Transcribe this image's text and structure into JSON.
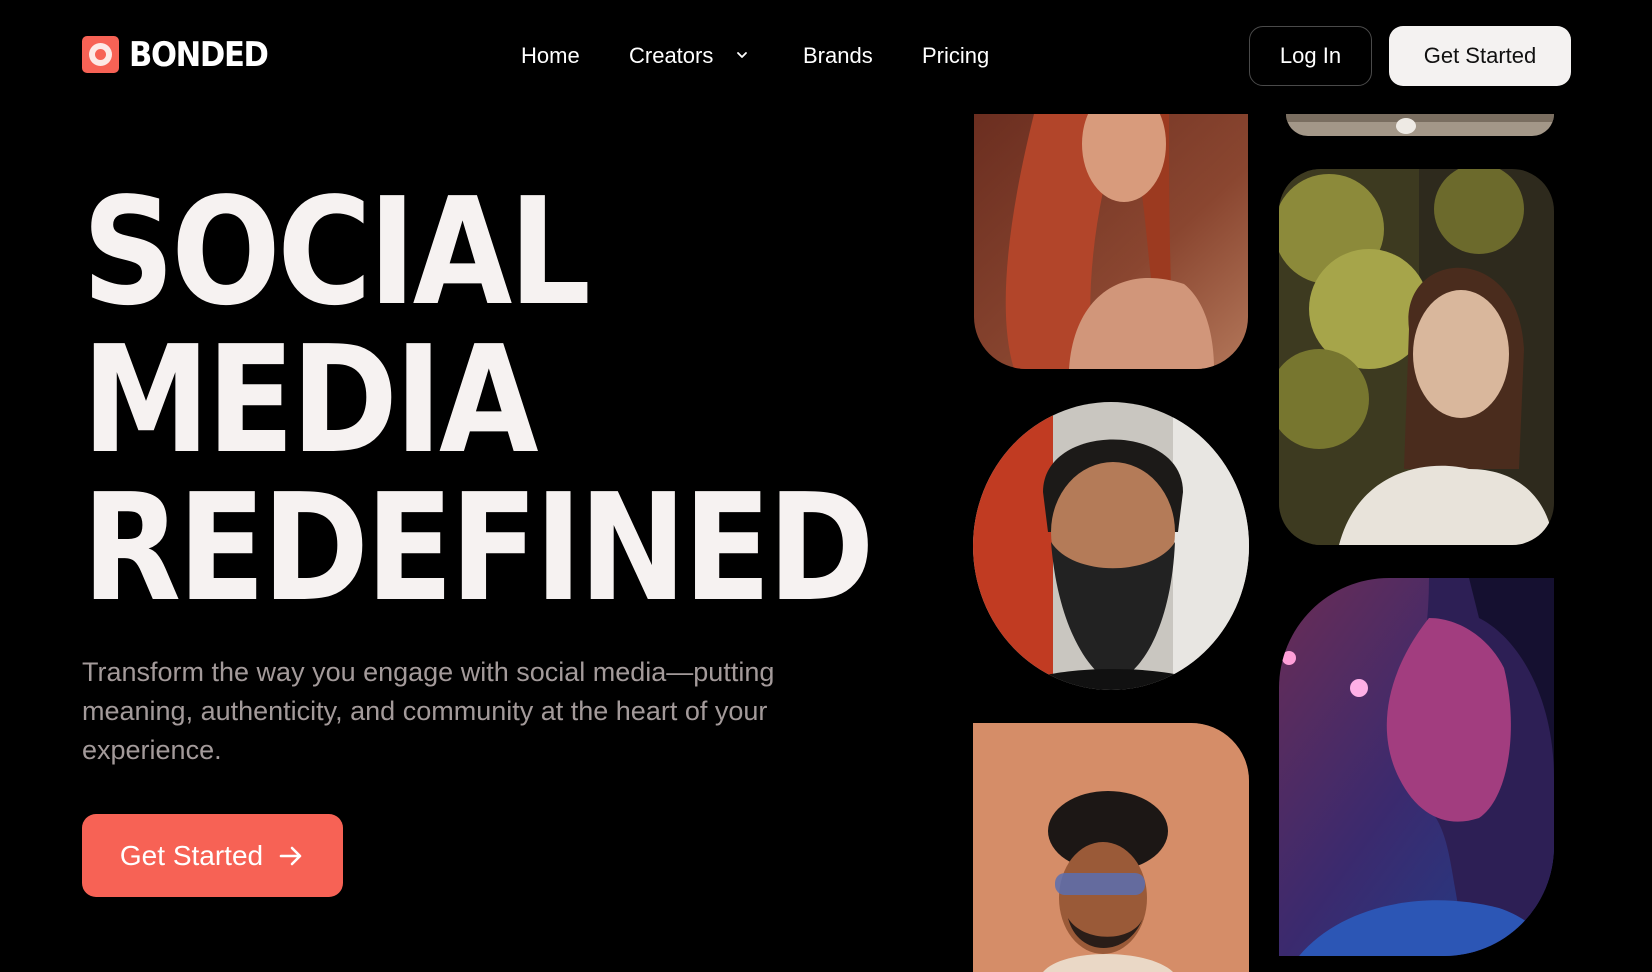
{
  "brand": {
    "name": "BONDED",
    "accent": "#f76255",
    "logo_icon": "flower-logo-icon"
  },
  "nav": {
    "items": [
      "Home",
      "Creators",
      "Brands",
      "Pricing"
    ],
    "creators_icon": "chevron-down-icon"
  },
  "header": {
    "login_label": "Log In",
    "get_started_label": "Get Started"
  },
  "hero": {
    "title_lines": [
      "SOCIAL",
      "MEDIA",
      "REDEFINED"
    ],
    "subtitle": "Transform the way you engage with social media—putting meaning, authenticity, and community at the heart of your experience.",
    "cta_label": "Get Started",
    "cta_icon": "arrow-right-icon"
  },
  "colors": {
    "background": "#000000",
    "text": "#f4f2f1",
    "subtitle": "#a39a9a",
    "light_button": "#f4f2f1"
  }
}
